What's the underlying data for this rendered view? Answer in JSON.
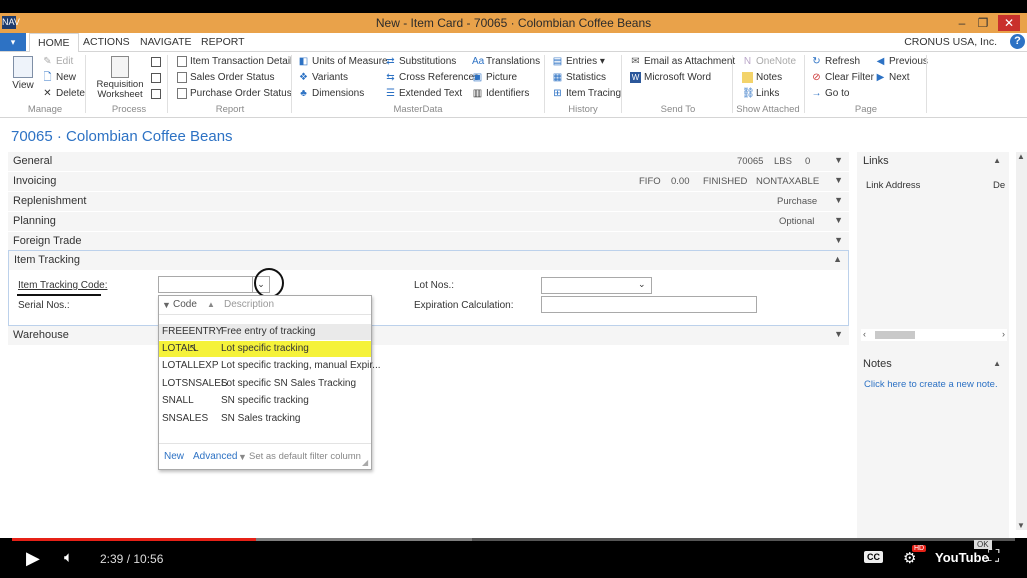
{
  "window": {
    "title": "New - Item Card - 70065 · Colombian Coffee Beans",
    "logo": "NAV",
    "controls": [
      "–",
      "❐",
      "✕"
    ]
  },
  "tabs": {
    "app_menu": "▾",
    "items": [
      "HOME",
      "ACTIONS",
      "NAVIGATE",
      "REPORT"
    ],
    "company": "CRONUS USA, Inc.",
    "help": "?"
  },
  "ribbon": {
    "manage": {
      "view": "View",
      "edit": "Edit",
      "new": "New",
      "delete": "Delete",
      "group": "Manage"
    },
    "process": {
      "requisition_1": "Requisition",
      "requisition_2": "Worksheet",
      "group": "Process"
    },
    "report": {
      "items": [
        "Item Transaction Detail",
        "Sales Order Status",
        "Purchase Order Status"
      ],
      "group": "Report"
    },
    "masterdata": {
      "col1": [
        "Units of Measure",
        "Variants",
        "Dimensions"
      ],
      "col2": [
        "Substitutions",
        "Cross References",
        "Extended Text"
      ],
      "col3": [
        "Translations",
        "Picture",
        "Identifiers"
      ],
      "group": "MasterData"
    },
    "history": {
      "items": [
        "Entries ▾",
        "Statistics",
        "Item Tracing"
      ],
      "group": "History"
    },
    "sendto": {
      "items": [
        "Email as Attachment",
        "Microsoft Word"
      ],
      "group": "Send To"
    },
    "attached": {
      "items": [
        "OneNote",
        "Notes",
        "Links"
      ],
      "group": "Show Attached"
    },
    "page": {
      "col1": [
        "Refresh",
        "Clear Filter",
        "Go to"
      ],
      "col2": [
        "Previous",
        "Next"
      ],
      "group": "Page"
    }
  },
  "page_title": "70065 · Colombian Coffee Beans",
  "fasttabs": {
    "general": {
      "label": "General",
      "sum": [
        "70065",
        "LBS",
        "0"
      ]
    },
    "invoicing": {
      "label": "Invoicing",
      "sum": [
        "FIFO",
        "0.00",
        "FINISHED",
        "NONTAXABLE"
      ]
    },
    "replenishment": {
      "label": "Replenishment",
      "sum": [
        "Purchase"
      ]
    },
    "planning": {
      "label": "Planning",
      "sum": [
        "Optional"
      ]
    },
    "foreign": {
      "label": "Foreign Trade"
    },
    "tracking": {
      "label": "Item Tracking"
    },
    "warehouse": {
      "label": "Warehouse"
    }
  },
  "tracking": {
    "item_tracking_code_label": "Item Tracking Code:",
    "item_tracking_code_value": "",
    "serial_nos_label": "Serial Nos.:",
    "lot_nos_label": "Lot Nos.:",
    "expiration_label": "Expiration Calculation:"
  },
  "dropdown": {
    "col_code": "Code",
    "col_desc": "Description",
    "rows": [
      {
        "code": "FREEENTRY",
        "desc": "Free entry of tracking"
      },
      {
        "code": "LOTALL",
        "desc": "Lot specific tracking"
      },
      {
        "code": "LOTALLEXP",
        "desc": "Lot specific tracking, manual Expir..."
      },
      {
        "code": "LOTSNSALES",
        "desc": "Lot specific SN Sales Tracking"
      },
      {
        "code": "SNALL",
        "desc": "SN specific tracking"
      },
      {
        "code": "SNSALES",
        "desc": "SN Sales tracking"
      }
    ],
    "footer_new": "New",
    "footer_advanced": "Advanced",
    "footer_default": "Set as default filter column",
    "highlight_color": "#f5f23a"
  },
  "factbox": {
    "links_title": "Links",
    "links_col": "Link Address",
    "links_col2": "De",
    "notes_title": "Notes",
    "notes_link": "Click here to create a new note."
  },
  "video": {
    "time": "2:39 / 10:56",
    "progress": 0.243,
    "cc": "CC",
    "hd": "HD",
    "youtube": "YouTube",
    "ok": "OK"
  }
}
